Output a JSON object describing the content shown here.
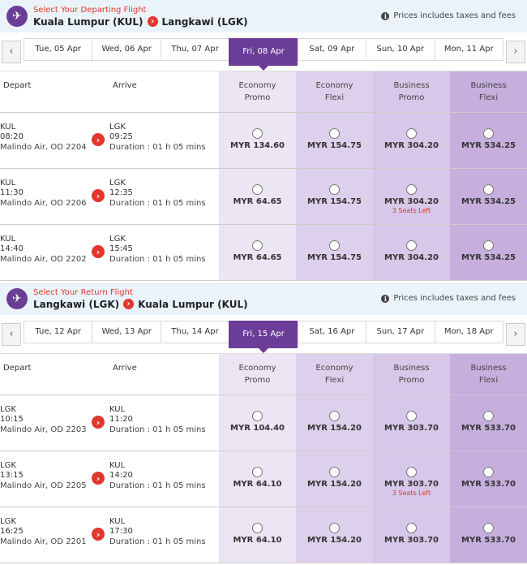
{
  "sections": [
    {
      "title": "Select Your Departing Flight",
      "origin": "Kuala Lumpur (KUL)",
      "destination": "Langkawi (LGK)",
      "info": "Prices includes taxes and fees",
      "dates": [
        "Tue, 05 Apr",
        "Wed, 06 Apr",
        "Thu, 07 Apr",
        "Fri, 08 Apr",
        "Sat, 09 Apr",
        "Sun, 10 Apr",
        "Mon, 11 Apr"
      ],
      "selected_date_index": 3,
      "columns": {
        "depart": "Depart",
        "arrive": "Arrive",
        "fares": [
          [
            "Economy",
            "Promo"
          ],
          [
            "Economy",
            "Flexi"
          ],
          [
            "Business",
            "Promo"
          ],
          [
            "Business",
            "Flexi"
          ]
        ]
      },
      "flights": [
        {
          "dep_code": "KUL",
          "dep_time": "08:20",
          "carrier": "Malindo Air, OD 2204",
          "arr_code": "LGK",
          "arr_time": "09:25",
          "duration": "Duration : 01 h 05 mins",
          "prices": [
            "MYR 134.60",
            "MYR 154.75",
            "MYR 304.20",
            "MYR 534.25"
          ],
          "seats": [
            "",
            "",
            "",
            ""
          ]
        },
        {
          "dep_code": "KUL",
          "dep_time": "11:30",
          "carrier": "Malindo Air, OD 2206",
          "arr_code": "LGK",
          "arr_time": "12:35",
          "duration": "Duration : 01 h 05 mins",
          "prices": [
            "MYR 64.65",
            "MYR 154.75",
            "MYR 304.20",
            "MYR 534.25"
          ],
          "seats": [
            "",
            "",
            "3 Seats Left",
            ""
          ]
        },
        {
          "dep_code": "KUL",
          "dep_time": "14:40",
          "carrier": "Malindo Air, OD 2202",
          "arr_code": "LGK",
          "arr_time": "15:45",
          "duration": "Duration : 01 h 05 mins",
          "prices": [
            "MYR 64.65",
            "MYR 154.75",
            "MYR 304.20",
            "MYR 534.25"
          ],
          "seats": [
            "",
            "",
            "",
            ""
          ]
        }
      ]
    },
    {
      "title": "Select Your Return Flight",
      "origin": "Langkawi (LGK)",
      "destination": "Kuala Lumpur (KUL)",
      "info": "Prices includes taxes and fees",
      "dates": [
        "Tue, 12 Apr",
        "Wed, 13 Apr",
        "Thu, 14 Apr",
        "Fri, 15 Apr",
        "Sat, 16 Apr",
        "Sun, 17 Apr",
        "Mon, 18 Apr"
      ],
      "selected_date_index": 3,
      "columns": {
        "depart": "Depart",
        "arrive": "Arrive",
        "fares": [
          [
            "Economy",
            "Promo"
          ],
          [
            "Economy",
            "Flexi"
          ],
          [
            "Business",
            "Promo"
          ],
          [
            "Business",
            "Flexi"
          ]
        ]
      },
      "flights": [
        {
          "dep_code": "LGK",
          "dep_time": "10:15",
          "carrier": "Malindo Air, OD 2203",
          "arr_code": "KUL",
          "arr_time": "11:20",
          "duration": "Duration : 01 h 05 mins",
          "prices": [
            "MYR 104.40",
            "MYR 154.20",
            "MYR 303.70",
            "MYR 533.70"
          ],
          "seats": [
            "",
            "",
            "",
            ""
          ]
        },
        {
          "dep_code": "LGK",
          "dep_time": "13:15",
          "carrier": "Malindo Air, OD 2205",
          "arr_code": "KUL",
          "arr_time": "14:20",
          "duration": "Duration : 01 h 05 mins",
          "prices": [
            "MYR 64.10",
            "MYR 154.20",
            "MYR 303.70",
            "MYR 533.70"
          ],
          "seats": [
            "",
            "",
            "3 Seats Left",
            ""
          ]
        },
        {
          "dep_code": "LGK",
          "dep_time": "16:25",
          "carrier": "Malindo Air, OD 2201",
          "arr_code": "KUL",
          "arr_time": "17:30",
          "duration": "Duration : 01 h 05 mins",
          "prices": [
            "MYR 64.10",
            "MYR 154.20",
            "MYR 303.70",
            "MYR 533.70"
          ],
          "seats": [
            "",
            "",
            "",
            ""
          ]
        }
      ]
    }
  ],
  "icons": {
    "plane": "plane-icon",
    "route_arrow": "arrow-right-circle-icon",
    "info": "info-icon",
    "prev": "chevron-left-icon",
    "next": "chevron-right-icon"
  },
  "colors": {
    "brand_purple": "#6c3d96",
    "accent_red": "#e2372d",
    "header_bg": "#eaf3fa"
  }
}
